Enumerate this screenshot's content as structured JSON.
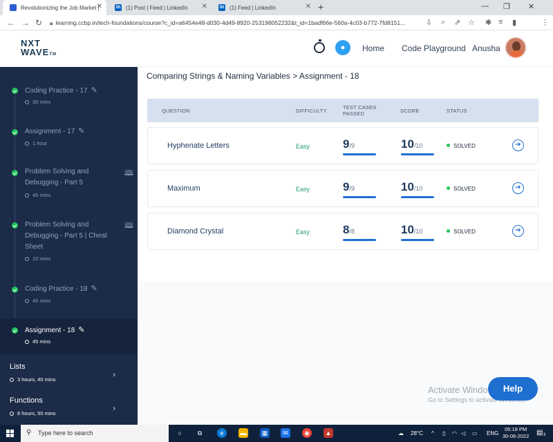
{
  "browser": {
    "tabs": [
      {
        "title": "Revolutionizing the Job Market |"
      },
      {
        "title": "(1) Post | Feed | LinkedIn"
      },
      {
        "title": "(1) Feed | LinkedIn"
      }
    ],
    "url": "learning.ccbp.in/tech-foundations/course?c_id=a6454e48-d030-4d49-8920-253198052232&t_id=1badf66e-560a-4c03-b772-7fd8151...",
    "profile_initial": "a"
  },
  "header": {
    "logo_line1": "NXT",
    "logo_line2": "WAVE",
    "logo_tm": "TM",
    "nav": {
      "home": "Home",
      "code_playground": "Code Playground",
      "user": "Anusha"
    }
  },
  "sidebar": {
    "items": [
      {
        "title": "Coding Practice - 17",
        "duration": "30 mins",
        "icon": "pencil-icon"
      },
      {
        "title": "Assignment - 17",
        "duration": "1 hour",
        "icon": "pencil-icon"
      },
      {
        "title_lines": [
          "Problem Solving and",
          "Debugging - Part 5"
        ],
        "duration": "45 mins",
        "icon": "book-icon"
      },
      {
        "title_lines": [
          "Problem Solving and",
          "Debugging - Part 5 | Cheat",
          "Sheet"
        ],
        "duration": "10 mins",
        "icon": "book-icon"
      },
      {
        "title": "Coding Practice - 18",
        "duration": "45 mins",
        "icon": "pencil-icon"
      },
      {
        "title": "Assignment - 18",
        "duration": "45 mins",
        "icon": "pencil-icon",
        "active": true
      }
    ],
    "modules": [
      {
        "title": "Lists",
        "duration": "3 hours, 40 mins"
      },
      {
        "title": "Functions",
        "duration": "6 hours, 50 mins"
      }
    ]
  },
  "main": {
    "breadcrumb": "Comparing Strings & Naming Variables > Assignment - 18",
    "columns": {
      "question": "QUESTION",
      "difficulty": "DIFFICULTY",
      "test_cases_line1": "TEST CASES",
      "test_cases_line2": "PASSED",
      "score": "SCORE",
      "status": "STATUS"
    },
    "rows": [
      {
        "question": "Hyphenate Letters",
        "difficulty": "Easy",
        "passed": "9",
        "total_cases": "/9",
        "score": "10",
        "max_score": "/10",
        "status": "SOLVED"
      },
      {
        "question": "Maximum",
        "difficulty": "Easy",
        "passed": "9",
        "total_cases": "/9",
        "score": "10",
        "max_score": "/10",
        "status": "SOLVED"
      },
      {
        "question": "Diamond Crystal",
        "difficulty": "Easy",
        "passed": "8",
        "total_cases": "/8",
        "score": "10",
        "max_score": "/10",
        "status": "SOLVED"
      }
    ],
    "watermark_line1": "Activate Windows",
    "watermark_line2": "Go to Settings to activate Windows.",
    "help": "Help"
  },
  "taskbar": {
    "search_placeholder": "Type here to search",
    "weather": "28°C",
    "language": "ENG",
    "time": "05:18 PM",
    "date": "30-06-2022",
    "notifications": "3"
  },
  "colors": {
    "sidebar_bg": "#1b2b48",
    "accent_blue": "#1f6fd1",
    "easy_green": "#22a06b",
    "solved_dot": "#22c55e",
    "table_header_bg": "#d7e0ef"
  }
}
